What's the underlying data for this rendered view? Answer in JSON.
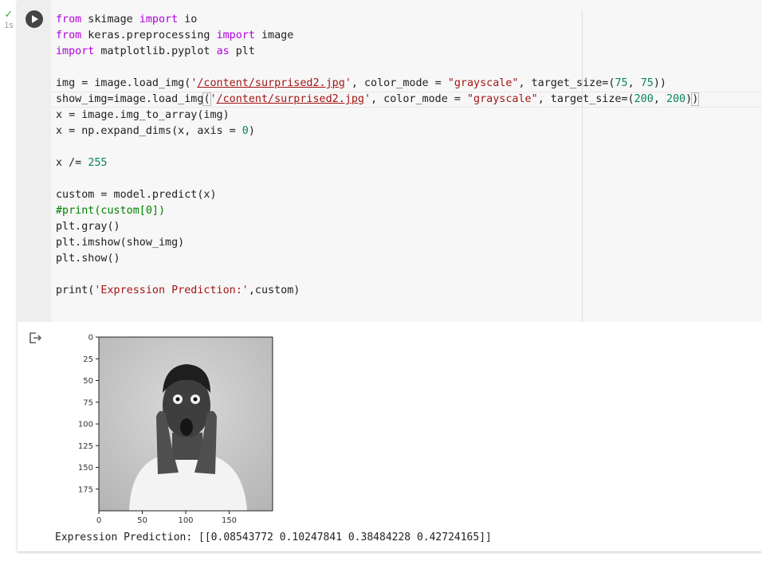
{
  "cell": {
    "exec_time": "1s",
    "code_lines": [
      [
        [
          "kw",
          "from"
        ],
        [
          "t",
          " skimage "
        ],
        [
          "kw",
          "import"
        ],
        [
          "t",
          " io"
        ]
      ],
      [
        [
          "kw",
          "from"
        ],
        [
          "t",
          " keras.preprocessing "
        ],
        [
          "kw",
          "import"
        ],
        [
          "t",
          " image"
        ]
      ],
      [
        [
          "kw",
          "import"
        ],
        [
          "t",
          " matplotlib.pyplot "
        ],
        [
          "kw",
          "as"
        ],
        [
          "t",
          " plt"
        ]
      ],
      [],
      [
        [
          "t",
          "img = image.load_img("
        ],
        [
          "str",
          "'"
        ],
        [
          "strul",
          "/content/surprised2.jpg"
        ],
        [
          "str",
          "'"
        ],
        [
          "t",
          ", color_mode = "
        ],
        [
          "str",
          "\"grayscale\""
        ],
        [
          "t",
          ", target_size=("
        ],
        [
          "num",
          "75"
        ],
        [
          "t",
          ", "
        ],
        [
          "num",
          "75"
        ],
        [
          "t",
          "))"
        ]
      ],
      [
        [
          "t",
          "show_img=image.load_img"
        ],
        [
          "br",
          "("
        ],
        [
          "str",
          "'"
        ],
        [
          "strul",
          "/content/surprised2.jpg"
        ],
        [
          "str",
          "'"
        ],
        [
          "t",
          ", color_mode = "
        ],
        [
          "str",
          "\"grayscale\""
        ],
        [
          "t",
          ", target_size=("
        ],
        [
          "num",
          "200"
        ],
        [
          "t",
          ", "
        ],
        [
          "num",
          "200"
        ],
        [
          "t",
          ")"
        ],
        [
          "br",
          ")"
        ]
      ],
      [
        [
          "t",
          "x = image.img_to_array(img)"
        ]
      ],
      [
        [
          "t",
          "x = np.expand_dims(x, axis = "
        ],
        [
          "num",
          "0"
        ],
        [
          "t",
          ")"
        ]
      ],
      [],
      [
        [
          "t",
          "x /= "
        ],
        [
          "num",
          "255"
        ]
      ],
      [],
      [
        [
          "t",
          "custom = model.predict(x)"
        ]
      ],
      [
        [
          "cmt",
          "#print(custom[0])"
        ]
      ],
      [
        [
          "t",
          "plt.gray()"
        ]
      ],
      [
        [
          "t",
          "plt.imshow(show_img)"
        ]
      ],
      [
        [
          "t",
          "plt.show()"
        ]
      ],
      [],
      [
        [
          "t",
          "print("
        ],
        [
          "str",
          "'Expression Prediction:'"
        ],
        [
          "t",
          ",custom)"
        ]
      ]
    ]
  },
  "output": {
    "plot": {
      "y_ticks": [
        "0",
        "25",
        "50",
        "75",
        "100",
        "125",
        "150",
        "175"
      ],
      "x_ticks": [
        "0",
        "50",
        "100",
        "150"
      ],
      "y_tick_values": [
        0,
        25,
        50,
        75,
        100,
        125,
        150,
        175
      ],
      "x_tick_values": [
        0,
        50,
        100,
        150
      ],
      "extent": [
        0,
        200
      ]
    },
    "prediction_text": "Expression Prediction: [[0.08543772 0.10247841 0.38484228 0.42724165]]"
  },
  "colors": {
    "keyword": "#af00db",
    "string": "#a31515",
    "number": "#098658",
    "comment": "#008000",
    "success_check": "#34a853"
  },
  "icons": {
    "status": "check-icon",
    "run": "play-icon",
    "output": "output-redirect-icon"
  }
}
